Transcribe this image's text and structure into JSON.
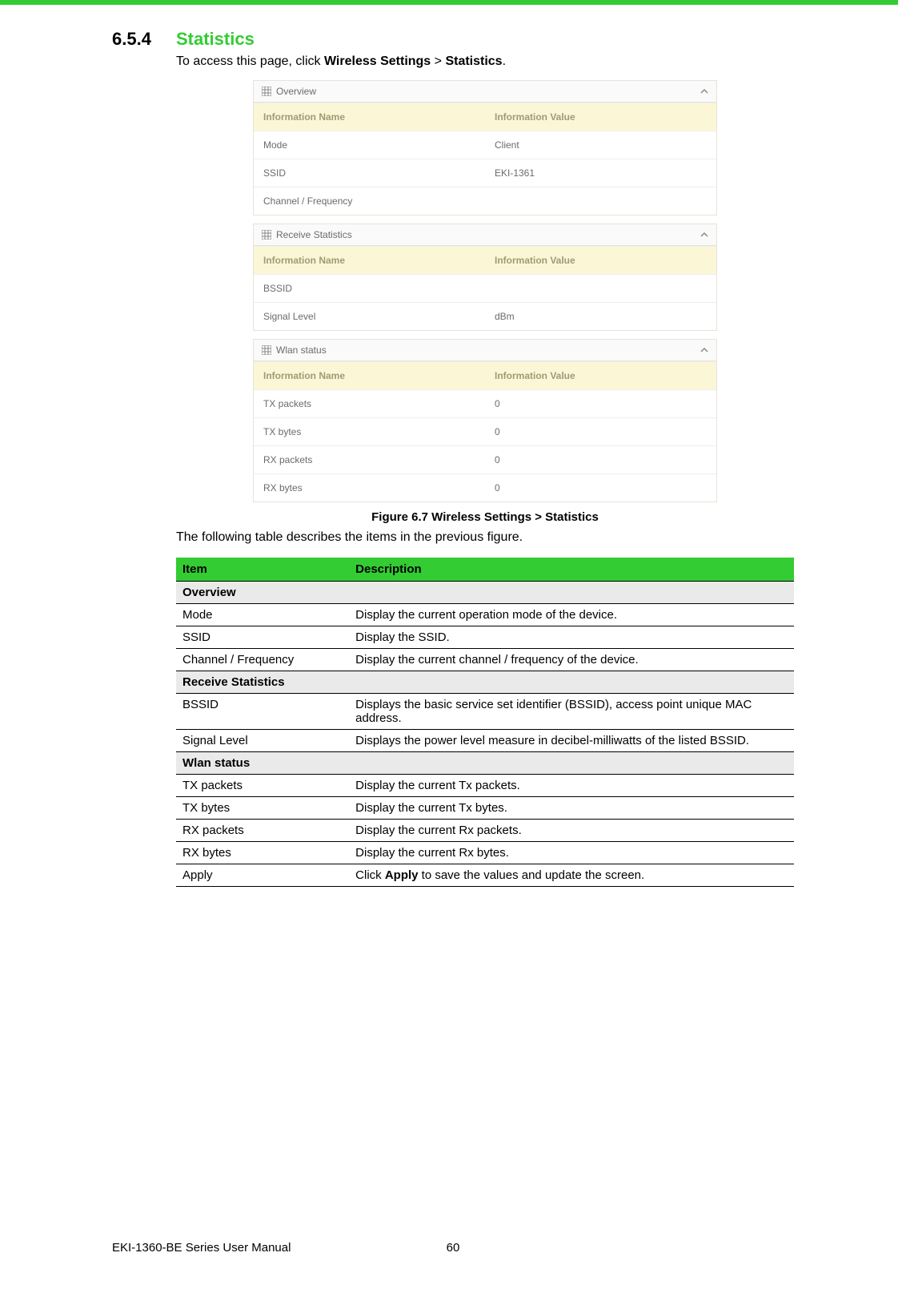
{
  "section": {
    "number": "6.5.4",
    "title": "Statistics"
  },
  "intro": {
    "prefix": "To access this page, click ",
    "bold1": "Wireless Settings",
    "sep": " > ",
    "bold2": "Statistics",
    "suffix": "."
  },
  "panels": [
    {
      "title": "Overview",
      "header": {
        "name": "Information Name",
        "value": "Information Value"
      },
      "rows": [
        {
          "name": "Mode",
          "value": "Client"
        },
        {
          "name": "SSID",
          "value": "EKI-1361"
        },
        {
          "name": "Channel / Frequency",
          "value": ""
        }
      ]
    },
    {
      "title": "Receive Statistics",
      "header": {
        "name": "Information Name",
        "value": "Information Value"
      },
      "rows": [
        {
          "name": "BSSID",
          "value": ""
        },
        {
          "name": "Signal Level",
          "value": "dBm"
        }
      ]
    },
    {
      "title": "Wlan status",
      "header": {
        "name": "Information Name",
        "value": "Information Value"
      },
      "rows": [
        {
          "name": "TX packets",
          "value": "0"
        },
        {
          "name": "TX bytes",
          "value": "0"
        },
        {
          "name": "RX packets",
          "value": "0"
        },
        {
          "name": "RX bytes",
          "value": "0"
        }
      ]
    }
  ],
  "figcap": "Figure 6.7 Wireless Settings > Statistics",
  "after_fig": "The following table describes the items in the previous figure.",
  "dtable": {
    "head": {
      "item": "Item",
      "desc": "Description"
    },
    "rows": [
      {
        "type": "sub",
        "item": "Overview",
        "desc": ""
      },
      {
        "type": "row",
        "item": "Mode",
        "desc": "Display the current operation mode of the device."
      },
      {
        "type": "row",
        "item": "SSID",
        "desc": "Display the SSID."
      },
      {
        "type": "row",
        "item": "Channel / Frequency",
        "desc": "Display the current channel / frequency of the device."
      },
      {
        "type": "sub",
        "item": "Receive Statistics",
        "desc": ""
      },
      {
        "type": "row",
        "item": "BSSID",
        "desc": "Displays the basic service set identifier (BSSID), access point unique MAC address."
      },
      {
        "type": "row",
        "item": "Signal Level",
        "desc": "Displays the power level measure in decibel-milliwatts of the listed BSSID."
      },
      {
        "type": "sub",
        "item": "Wlan status",
        "desc": ""
      },
      {
        "type": "row",
        "item": "TX packets",
        "desc": "Display the current Tx packets."
      },
      {
        "type": "row",
        "item": "TX bytes",
        "desc": "Display the current Tx bytes."
      },
      {
        "type": "row",
        "item": "RX packets",
        "desc": "Display the current Rx packets."
      },
      {
        "type": "row",
        "item": "RX bytes",
        "desc": "Display the current Rx bytes."
      },
      {
        "type": "row",
        "item": "Apply",
        "desc_prefix": "Click ",
        "desc_bold": "Apply",
        "desc_suffix": " to save the values and update the screen."
      }
    ]
  },
  "footer": {
    "manual": "EKI-1360-BE Series User Manual",
    "page": "60"
  }
}
